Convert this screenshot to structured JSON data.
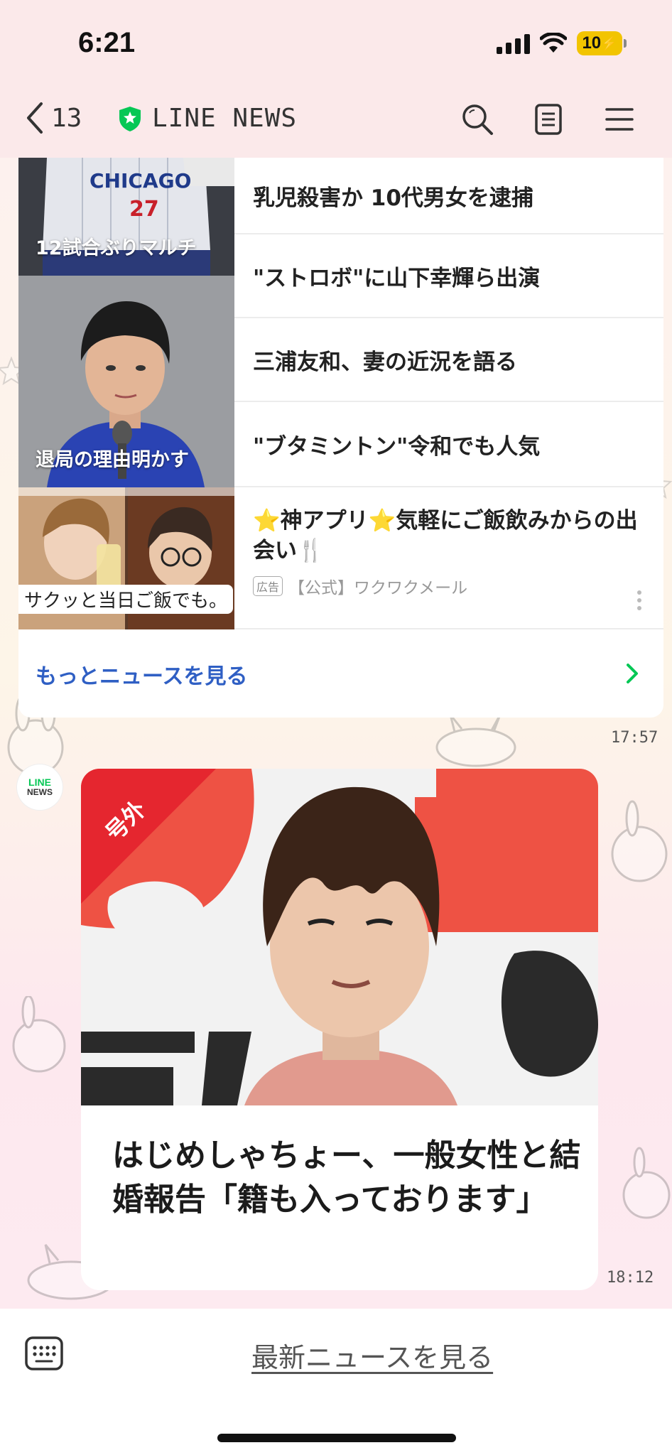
{
  "status_bar": {
    "time": "6:21",
    "battery": "10"
  },
  "nav": {
    "back_count": "13",
    "title": "LINE NEWS"
  },
  "news_list": {
    "items": [
      {
        "title": "乳児殺害か 10代男女を逮捕"
      },
      {
        "title": "\"ストロボ\"に山下幸輝ら出演"
      },
      {
        "title": "三浦友和、妻の近況を語る"
      },
      {
        "title": "\"ブタミントン\"令和でも人気"
      }
    ],
    "thumbs": [
      {
        "caption": "12試合ぶりマルチ",
        "jersey_text": "CHICAGO",
        "jersey_number": "27"
      },
      {
        "caption": "退局の理由明かす"
      }
    ],
    "ad": {
      "title": "⭐神アプリ⭐気軽にご飯飲みからの出会い🍴",
      "badge": "広告",
      "advertiser": "【公式】ワクワクメール",
      "thumb_caption": "サクッと当日ご飯でも。"
    },
    "more_link": "もっとニュースを見る"
  },
  "timestamps": {
    "first": "17:57",
    "second": "18:12"
  },
  "avatar": {
    "line1": "LINE",
    "line2": "NEWS"
  },
  "breaking": {
    "badge": "号外",
    "title": "はじめしゃちょー、一般女性と結婚報告「籍も入っております」"
  },
  "bottom": {
    "latest_link": "最新ニュースを見る"
  },
  "colors": {
    "line_green": "#06c755",
    "link_blue": "#2f5fc4",
    "breaking_red": "#e5262f"
  }
}
